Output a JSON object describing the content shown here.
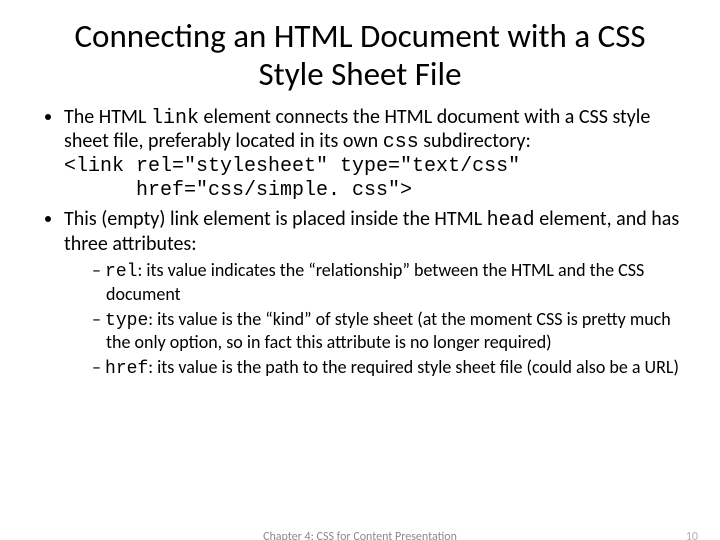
{
  "title": "Connecting an HTML Document with a CSS Style Sheet File",
  "bullet1": {
    "pre": "The HTML ",
    "code1": "link",
    "mid": " element connects the HTML document with a CSS style sheet file, preferably located in its own ",
    "code2": "css",
    "post": " subdirectory:",
    "codeLine1": "<link rel=\"stylesheet\" type=\"text/css\"",
    "codeLine2": "      href=\"css/simple. css\">"
  },
  "bullet2": {
    "pre": "This (empty) link element is placed inside the HTML ",
    "code1": "head",
    "post": " element, and has three attributes:"
  },
  "sub": [
    {
      "code": "rel",
      "text": ": its value indicates the “relationship” between the HTML and the CSS document"
    },
    {
      "code": "type",
      "text": ": its value is the “kind” of style sheet (at the moment CSS is pretty much the only option, so in fact this attribute is no longer required)"
    },
    {
      "code": "href",
      "text": ": its value is the path to the required style sheet file (could also be a URL)"
    }
  ],
  "footer": {
    "chapter": "Chapter 4: CSS for Content Presentation",
    "page": "10"
  }
}
